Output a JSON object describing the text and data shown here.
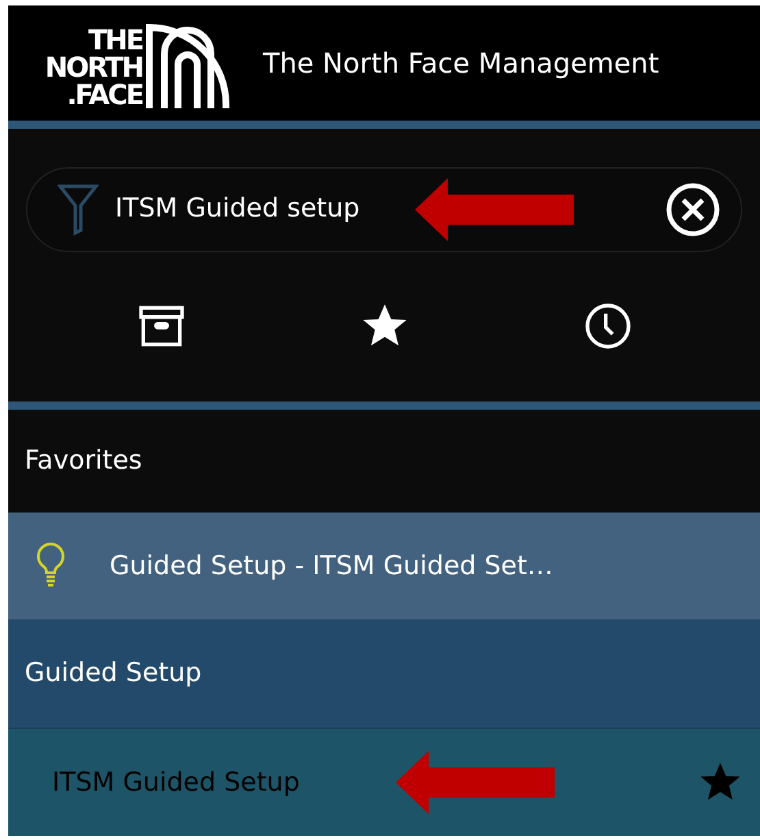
{
  "header": {
    "logo_lines": [
      "THE",
      "NORTH",
      ".FACE"
    ],
    "title": "The North Face Management"
  },
  "search": {
    "value": "ITSM Guided setup",
    "annotation_arrow": true
  },
  "icon_tabs": [
    {
      "kind": "archive"
    },
    {
      "kind": "star"
    },
    {
      "kind": "clock"
    }
  ],
  "favorites": {
    "heading": "Favorites",
    "items": [
      {
        "label": "Guided Setup - ITSM Guided Set…",
        "kind": "lightbulb"
      }
    ]
  },
  "groups": [
    {
      "heading": "Guided Setup",
      "items": [
        {
          "label": "ITSM Guided Setup",
          "favorite": true,
          "annotation_arrow": true
        }
      ]
    }
  ]
}
